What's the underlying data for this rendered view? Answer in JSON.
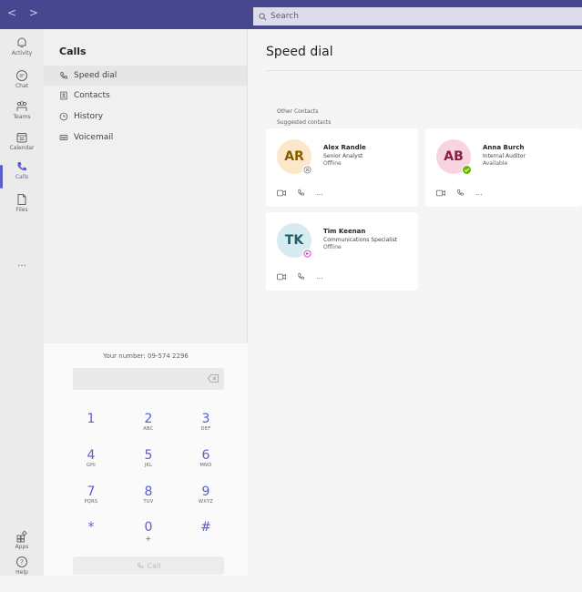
{
  "titlebar": {
    "back": "<",
    "forward": ">",
    "search_placeholder": "Search"
  },
  "rail": {
    "items": [
      {
        "label": "Activity",
        "icon": "bell-icon"
      },
      {
        "label": "Chat",
        "icon": "chat-icon"
      },
      {
        "label": "Teams",
        "icon": "teams-icon"
      },
      {
        "label": "Calendar",
        "icon": "calendar-icon"
      },
      {
        "label": "Calls",
        "icon": "phone-icon"
      },
      {
        "label": "Files",
        "icon": "file-icon"
      }
    ],
    "more": "...",
    "apps": "Apps",
    "help": "Help"
  },
  "calls": {
    "title": "Calls",
    "nav": [
      "Speed dial",
      "Contacts",
      "History",
      "Voicemail"
    ]
  },
  "dialpad": {
    "your_number": "Your number: 09-574 2296",
    "keys": [
      {
        "d": "1",
        "l": ""
      },
      {
        "d": "2",
        "l": "ABC"
      },
      {
        "d": "3",
        "l": "DEF"
      },
      {
        "d": "4",
        "l": "GHI"
      },
      {
        "d": "5",
        "l": "JKL"
      },
      {
        "d": "6",
        "l": "MNO"
      },
      {
        "d": "7",
        "l": "PQRS"
      },
      {
        "d": "8",
        "l": "TUV"
      },
      {
        "d": "9",
        "l": "WXYZ"
      },
      {
        "d": "*",
        "l": ""
      },
      {
        "d": "0",
        "l": "+"
      },
      {
        "d": "#",
        "l": ""
      }
    ],
    "call_label": "Call"
  },
  "main": {
    "title": "Speed dial",
    "other_contacts": "Other Contacts",
    "suggested_contacts": "Suggested contacts",
    "contacts": [
      {
        "initials": "AR",
        "name": "Alex Randle",
        "role": "Senior Analyst",
        "status": "Offline",
        "avatar_bg": "#fce8c8",
        "avatar_fg": "#8a5a00",
        "presence": "offline"
      },
      {
        "initials": "AB",
        "name": "Anna Burch",
        "role": "Internal Auditor",
        "status": "Available",
        "avatar_bg": "#f8d3e0",
        "avatar_fg": "#8b1a45",
        "presence": "available"
      },
      {
        "initials": "TK",
        "name": "Tim Keenan",
        "role": "Communications Specialist",
        "status": "Offline",
        "avatar_bg": "#d7ecf0",
        "avatar_fg": "#1f5d6a",
        "presence": "oof"
      }
    ],
    "more_label": "..."
  },
  "colors": {
    "titlebar": "#46478f",
    "accent": "#5b5fc7",
    "available": "#6bb700",
    "oof": "#c239b3"
  }
}
